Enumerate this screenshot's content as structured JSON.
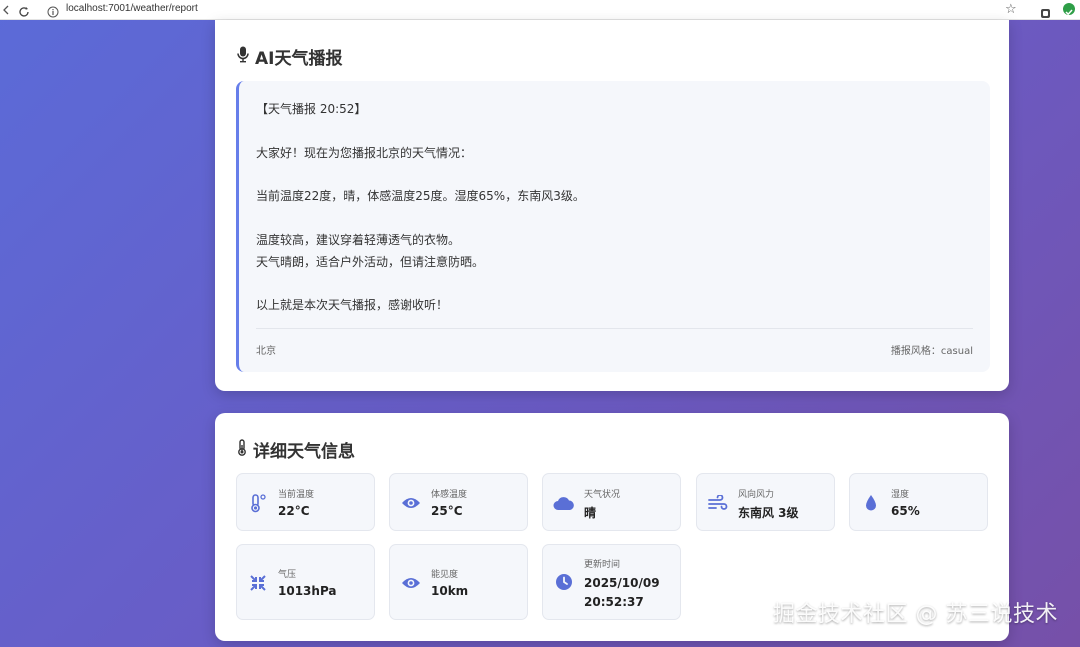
{
  "browser": {
    "url": "localhost:7001/weather/report"
  },
  "report_card": {
    "title": "AI天气播报",
    "lines": [
      "【天气播报 20:52】",
      "大家好！现在为您播报北京的天气情况：",
      "当前温度22度，晴，体感温度25度。湿度65%，东南风3级。",
      "温度较高，建议穿着轻薄透气的衣物。",
      "天气晴朗，适合户外活动，但请注意防晒。",
      "以上就是本次天气播报，感谢收听！"
    ],
    "city": "北京",
    "style_label": "播报风格：casual"
  },
  "detail_card": {
    "title": "详细天气信息",
    "tiles": [
      {
        "label": "当前温度",
        "value": "22°C",
        "icon": "thermometer-icon"
      },
      {
        "label": "体感温度",
        "value": "25°C",
        "icon": "eye-icon"
      },
      {
        "label": "天气状况",
        "value": "晴",
        "icon": "cloud-icon"
      },
      {
        "label": "风向风力",
        "value": "东南风 3级",
        "icon": "wind-icon"
      },
      {
        "label": "湿度",
        "value": "65%",
        "icon": "droplet-icon"
      },
      {
        "label": "气压",
        "value": "1013hPa",
        "icon": "compress-icon"
      },
      {
        "label": "能见度",
        "value": "10km",
        "icon": "eye-icon"
      },
      {
        "label": "更新时间",
        "value_date": "2025/10/09",
        "value_time": "20:52:37",
        "icon": "clock-icon"
      }
    ]
  },
  "watermark": "掘金技术社区 @ 苏三说技术",
  "colors": {
    "accent": "#667eea",
    "icon": "#5a6fd6"
  }
}
